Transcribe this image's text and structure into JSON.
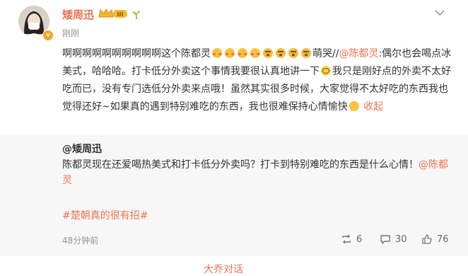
{
  "post": {
    "author": "矮周迅",
    "timestamp": "刚刚",
    "badge_label": "III",
    "segments": [
      {
        "text": "啊啊啊啊啊啊啊啊啊啊这个陈都灵",
        "kind": "text"
      },
      {
        "kind": "emoji",
        "emoji": "blush"
      },
      {
        "kind": "emoji",
        "emoji": "blush"
      },
      {
        "kind": "emoji",
        "emoji": "blush"
      },
      {
        "kind": "emoji",
        "emoji": "blush"
      },
      {
        "kind": "emoji",
        "emoji": "cry"
      },
      {
        "kind": "emoji",
        "emoji": "cry"
      },
      {
        "kind": "emoji",
        "emoji": "cry"
      },
      {
        "kind": "emoji",
        "emoji": "cry"
      },
      {
        "text": "萌哭//",
        "kind": "text"
      },
      {
        "text": "@陈都灵",
        "kind": "mention"
      },
      {
        "text": ":偶尔也会喝点冰美式，哈哈哈。打卡低分外卖这个事情我要很认真地讲一下",
        "kind": "text"
      },
      {
        "kind": "emoji",
        "emoji": "swirl"
      },
      {
        "text": "我只是刚好点的外卖不太好吃而已，没有专门选低分外卖来点哦！虽然其实很多时候，大家觉得不太好吃的东西我也觉得还好~如果真的遇到特别难吃的东西，我也很难保持心情愉快",
        "kind": "text"
      },
      {
        "kind": "emoji",
        "emoji": "sad"
      },
      {
        "text": " 收起",
        "kind": "collapse"
      }
    ]
  },
  "repost": {
    "author": "@矮周迅",
    "text": "陈都灵现在还爱喝热美式和打卡低分外卖吗？打卡到特别难吃的东西是什么心情！",
    "mention": "@陈都灵",
    "hashtag": "#楚朝真的很有招#",
    "time": "48分钟前",
    "stats": {
      "reposts": "6",
      "comments": "30",
      "likes": "76"
    }
  },
  "bottom_link": "大乔对话"
}
